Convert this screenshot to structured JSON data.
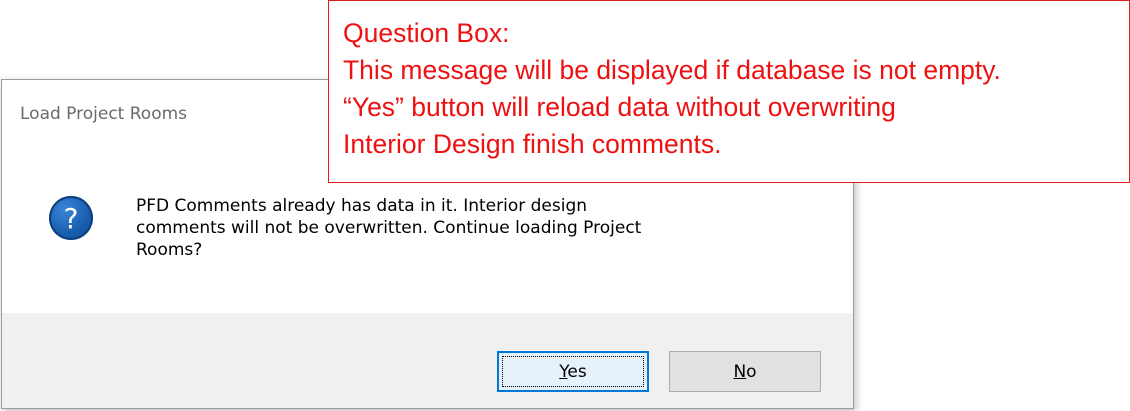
{
  "dialog": {
    "title": "Load Project Rooms",
    "icon": "question-icon",
    "message": "PFD Comments already has data in it.  Interior design\ncomments will not be overwritten.  Continue loading Project\nRooms?",
    "buttons": {
      "yes": {
        "accel": "Y",
        "rest": "es"
      },
      "no": {
        "accel": "N",
        "rest": "o"
      }
    }
  },
  "callout": {
    "heading": "Question Box:",
    "body": "This message will be displayed if database is not empty.\n“Yes” button will reload data without overwriting\nInterior Design finish comments.",
    "color": "#ee1111"
  },
  "colors": {
    "icon_blue": "#1a5fb0",
    "default_button_border": "#0078d7",
    "footer_bg": "#f0f0f0"
  }
}
